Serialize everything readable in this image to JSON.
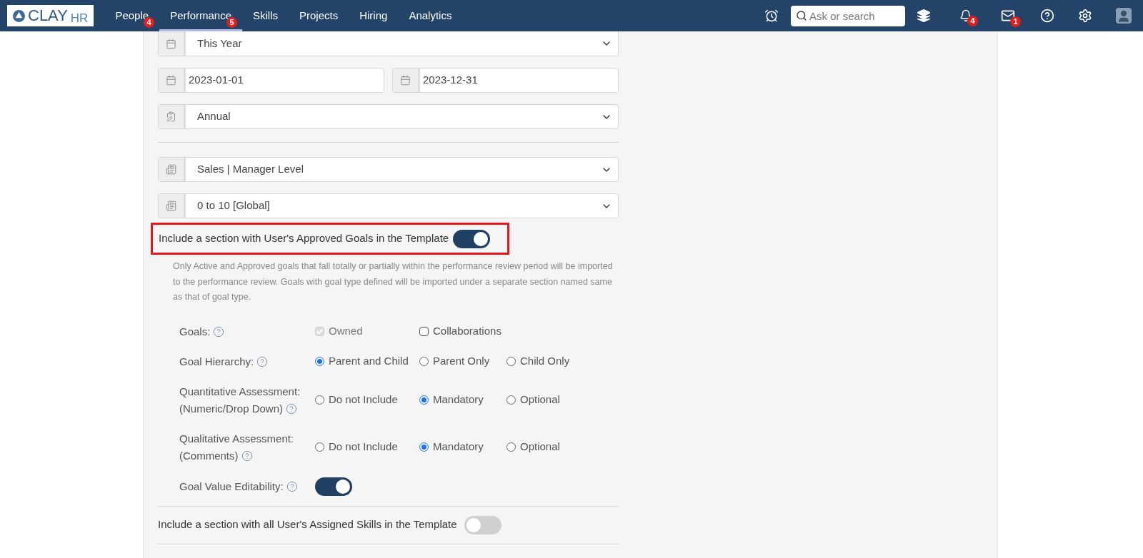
{
  "nav": {
    "logo": {
      "name": "CLAY",
      "suffix": "HR"
    },
    "items": [
      {
        "label": "People",
        "badge": "4",
        "selected": false
      },
      {
        "label": "Performance",
        "badge": "5",
        "selected": true
      },
      {
        "label": "Skills",
        "selected": false
      },
      {
        "label": "Projects",
        "selected": false
      },
      {
        "label": "Hiring",
        "selected": false
      },
      {
        "label": "Analytics",
        "selected": false
      }
    ],
    "search": {
      "placeholder": "Ask or search"
    },
    "notifications_badge": "4",
    "mail_badge": "1"
  },
  "form": {
    "period": "This Year",
    "start_date": "2023-01-01",
    "end_date": "2023-12-31",
    "frequency": "Annual",
    "template": "Sales | Manager Level",
    "rating_scale": "0 to 10 [Global]",
    "goals_section": {
      "label": "Include a section with User's Approved Goals in the Template",
      "on": true,
      "highlighted": true,
      "description": "Only Active and Approved goals that fall totally or partially within the performance review period will be imported to the performance review. Goals with goal type defined will be imported under a separate section named same as that of goal type.",
      "settings": [
        {
          "kind": "checkboxes",
          "label": "Goals:",
          "options": [
            {
              "label": "Owned",
              "checked": true,
              "disabled": true
            },
            {
              "label": "Collaborations",
              "checked": false,
              "disabled": false
            }
          ]
        },
        {
          "kind": "radios",
          "label": "Goal Hierarchy:",
          "options": [
            {
              "label": "Parent and Child",
              "selected": true
            },
            {
              "label": "Parent Only",
              "selected": false
            },
            {
              "label": "Child Only",
              "selected": false
            }
          ]
        },
        {
          "kind": "radios",
          "label": "Quantitative Assessment:",
          "sublabel": "(Numeric/Drop Down)",
          "options": [
            {
              "label": "Do not Include",
              "selected": false
            },
            {
              "label": "Mandatory",
              "selected": true
            },
            {
              "label": "Optional",
              "selected": false
            }
          ]
        },
        {
          "kind": "radios",
          "label": "Qualitative Assessment:",
          "sublabel": "(Comments)",
          "options": [
            {
              "label": "Do not Include",
              "selected": false
            },
            {
              "label": "Mandatory",
              "selected": true
            },
            {
              "label": "Optional",
              "selected": false
            }
          ]
        },
        {
          "kind": "toggle",
          "label": "Goal Value Editability:",
          "on": true
        }
      ]
    },
    "skills_section": {
      "label": "Include a section with all User's Assigned Skills in the Template",
      "on": false
    }
  }
}
